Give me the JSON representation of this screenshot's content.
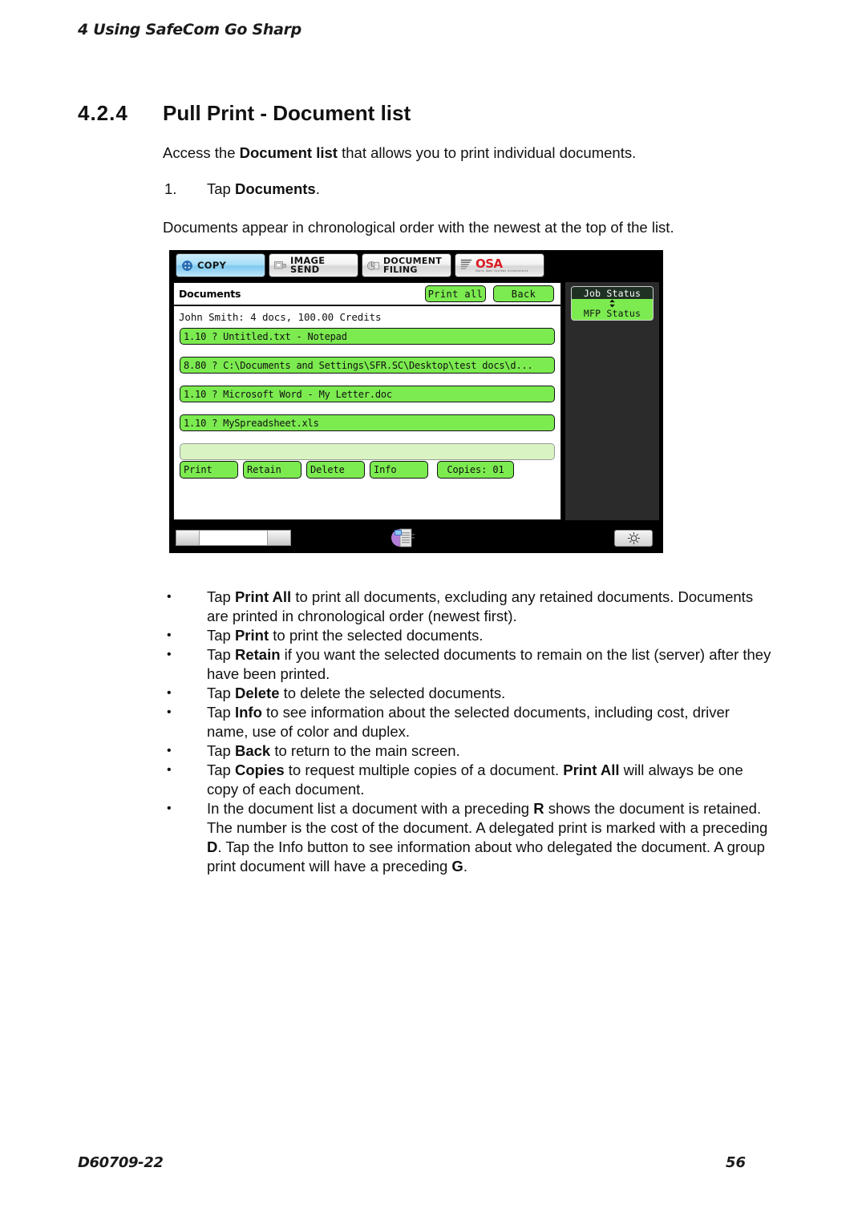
{
  "page": {
    "running_header": "4 Using SafeCom Go Sharp",
    "footer_doc_id": "D60709-22",
    "footer_page_number": "56",
    "section_number": "4.2.4",
    "section_title": "Pull Print - Document list",
    "intro_paragraph_prefix": "Access the ",
    "intro_paragraph_bold": "Document list",
    "intro_paragraph_suffix": " that allows you to print individual documents.",
    "step_number": "1.",
    "step_prefix": "Tap ",
    "step_bold": "Documents",
    "step_suffix": ".",
    "note_paragraph": "Documents appear in chronological order with the newest at the top of the list."
  },
  "bullets": [
    "Tap <b>Print All</b> to print all documents, excluding any retained documents. Documents are printed in chronological order (newest first).",
    "Tap <b>Print</b> to print the selected documents.",
    "Tap <b>Retain</b> if you want the selected documents to remain on the list (server) after they have been printed.",
    "Tap <b>Delete</b> to delete the selected documents.",
    "Tap <b>Info</b> to see information about the selected documents, including cost, driver name, use of color and duplex.",
    "Tap <b>Back</b> to return to the main screen.",
    "Tap <b>Copies</b> to request multiple copies of a document. <b>Print All</b> will always be one copy of each document.",
    "In the document list a document with a preceding <b>R</b> shows the document is retained. The number is the cost of the document. A delegated print is marked with a preceding <b>D</b>. Tap the Info button to see information about who delegated the document. A group print document will have a preceding <b>G</b>."
  ],
  "bullet_marker": "•",
  "device": {
    "tabs": [
      {
        "label": "COPY",
        "icon": "copy-icon",
        "active": true
      },
      {
        "label": "IMAGE SEND",
        "icon": "image-send-icon",
        "active": false
      },
      {
        "label": "DOCUMENT\nFILING",
        "icon": "document-filing-icon",
        "active": false
      },
      {
        "label": "OSA",
        "icon": "osa-logo-icon",
        "active": false,
        "sublabel": "Sharp Open Systems Architecture"
      }
    ],
    "panel": {
      "title": "Documents",
      "header_buttons": [
        {
          "label": "Print all"
        },
        {
          "label": "Back"
        }
      ],
      "user_summary": "John Smith: 4 docs, 100.00 Credits",
      "documents": [
        {
          "text": "1.10 ? Untitled.txt - Notepad"
        },
        {
          "text": "8.80 ? C:\\Documents and Settings\\SFR.SC\\Desktop\\test docs\\d..."
        },
        {
          "text": "1.10 ? Microsoft Word - My Letter.doc"
        },
        {
          "text": "1.10 ? MySpreadsheet.xls"
        },
        {
          "text": ""
        }
      ],
      "action_buttons": [
        {
          "label": "Print"
        },
        {
          "label": "Retain"
        },
        {
          "label": "Delete"
        },
        {
          "label": "Info"
        },
        {
          "label": "Copies: 01"
        }
      ]
    },
    "status_panel": {
      "job_status_label": "Job Status",
      "mfp_status_label": "MFP Status",
      "toggle_icon": "up-down-arrows-icon"
    },
    "bottom_bar": {
      "slider_icon": "contrast-slider",
      "printer_icon": "printer-icon",
      "brightness_icon": "brightness-icon"
    },
    "colors": {
      "button_green": "#7ceb50",
      "empty_row_green": "#d9f4c2",
      "active_tab_blue": "#a8dff8",
      "status_panel_dark": "#2b2b2b",
      "job_status_header": "#1f3123",
      "osa_red": "#d81e25"
    }
  }
}
